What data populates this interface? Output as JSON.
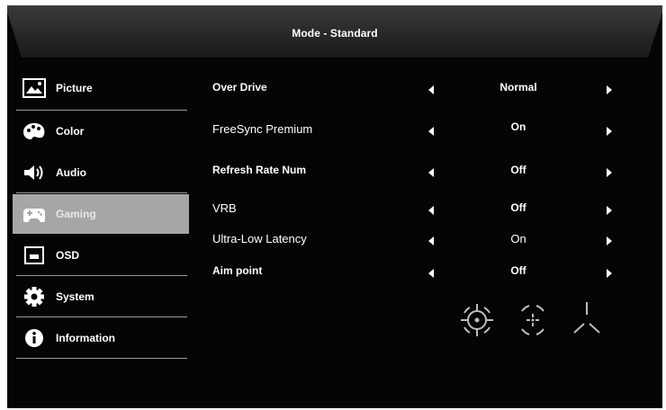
{
  "window": {
    "title": "Mode - Standard"
  },
  "sidebar": {
    "items": [
      {
        "label": "Picture",
        "icon": "picture-icon",
        "active": false
      },
      {
        "label": "Color",
        "icon": "palette-icon",
        "active": false
      },
      {
        "label": "Audio",
        "icon": "speaker-icon",
        "active": false
      },
      {
        "label": "Gaming",
        "icon": "gamepad-icon",
        "active": true
      },
      {
        "label": "OSD",
        "icon": "osd-icon",
        "active": false
      },
      {
        "label": "System",
        "icon": "gear-icon",
        "active": false
      },
      {
        "label": "Information",
        "icon": "info-icon",
        "active": false
      }
    ]
  },
  "settings": {
    "rows": [
      {
        "label": "Over Drive",
        "value": "Normal"
      },
      {
        "label": "FreeSync Premium",
        "value": "On"
      },
      {
        "label": "Refresh Rate Num",
        "value": "Off"
      },
      {
        "label": "VRB",
        "value": "Off"
      },
      {
        "label": "Ultra-Low Latency",
        "value": "On"
      },
      {
        "label": "Aim point",
        "value": "Off"
      }
    ]
  },
  "aim_point_styles": [
    "crosshair-circle-icon",
    "crosshair-dot-icon",
    "crosshair-tri-icon"
  ],
  "colors": {
    "background": "#050505",
    "active_item": "#a6a6a6",
    "text": "#ffffff"
  }
}
